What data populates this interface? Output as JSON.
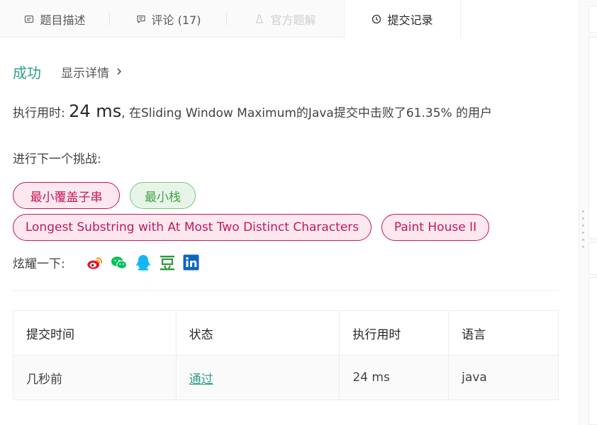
{
  "tabs": [
    {
      "label": "题目描述",
      "icon": "description-icon"
    },
    {
      "label": "评论 (17)",
      "icon": "comment-icon"
    },
    {
      "label": "官方题解",
      "icon": "flask-icon",
      "disabled": true
    },
    {
      "label": "提交记录",
      "icon": "clock-icon",
      "active": true
    }
  ],
  "result": {
    "status": "成功",
    "details_label": "显示详情",
    "runtime_prefix": "执行用时: ",
    "runtime_value": "24 ms",
    "runtime_suffix": ", 在Sliding Window Maximum的Java提交中击败了61.35% 的用户"
  },
  "challenge": {
    "heading": "进行下一个挑战:",
    "problems": [
      {
        "title": "最小覆盖子串",
        "difficulty": "hard"
      },
      {
        "title": "最小栈",
        "difficulty": "easy"
      },
      {
        "title": "Longest Substring with At Most Two Distinct Characters",
        "difficulty": "hard"
      },
      {
        "title": "Paint House II",
        "difficulty": "hard"
      }
    ]
  },
  "share": {
    "label": "炫耀一下:",
    "icons": [
      "weibo-icon",
      "wechat-icon",
      "qq-icon",
      "douban-icon",
      "linkedin-icon"
    ]
  },
  "table": {
    "headers": [
      "提交时间",
      "状态",
      "执行用时",
      "语言"
    ],
    "rows": [
      [
        "几秒前",
        "通过",
        "24 ms",
        "java"
      ]
    ]
  },
  "colors": {
    "accent": "#2f9e8f",
    "hard": "#c2185b",
    "hard_bg": "#fde8ef",
    "easy": "#43a047",
    "easy_bg": "#e7f5e8"
  }
}
